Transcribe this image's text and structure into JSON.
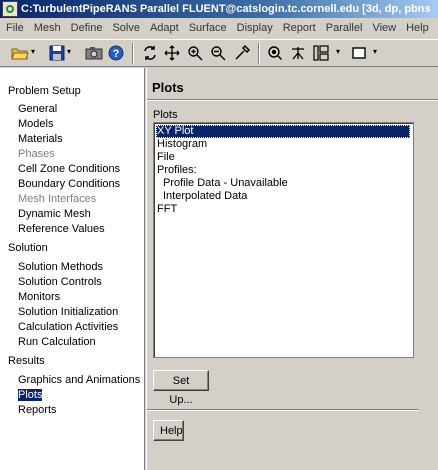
{
  "window": {
    "title": "C:TurbulentPipeRANS Parallel FLUENT@catslogin.tc.cornell.edu  [3d, dp, pbns"
  },
  "menubar": [
    "File",
    "Mesh",
    "Define",
    "Solve",
    "Adapt",
    "Surface",
    "Display",
    "Report",
    "Parallel",
    "View",
    "Help"
  ],
  "toolbar": {
    "icons": [
      "open-folder-icon",
      "save-icon",
      "screenshot-icon",
      "help-icon",
      "rotate-icon",
      "pan-icon",
      "zoom-in-out-icon",
      "zoom-to-area-icon",
      "probe-icon",
      "fit-to-window-icon",
      "mouse-probe-icon",
      "view-layout-icon",
      "display-box-icon"
    ]
  },
  "tree": {
    "sections": [
      {
        "header": "Problem Setup",
        "items": [
          {
            "label": "General",
            "disabled": false
          },
          {
            "label": "Models",
            "disabled": false
          },
          {
            "label": "Materials",
            "disabled": false
          },
          {
            "label": "Phases",
            "disabled": true
          },
          {
            "label": "Cell Zone Conditions",
            "disabled": false
          },
          {
            "label": "Boundary Conditions",
            "disabled": false
          },
          {
            "label": "Mesh Interfaces",
            "disabled": true
          },
          {
            "label": "Dynamic Mesh",
            "disabled": false
          },
          {
            "label": "Reference Values",
            "disabled": false
          }
        ]
      },
      {
        "header": "Solution",
        "items": [
          {
            "label": "Solution Methods",
            "disabled": false
          },
          {
            "label": "Solution Controls",
            "disabled": false
          },
          {
            "label": "Monitors",
            "disabled": false
          },
          {
            "label": "Solution Initialization",
            "disabled": false
          },
          {
            "label": "Calculation Activities",
            "disabled": false
          },
          {
            "label": "Run Calculation",
            "disabled": false
          }
        ]
      },
      {
        "header": "Results",
        "items": [
          {
            "label": "Graphics and Animations",
            "disabled": false
          },
          {
            "label": "Plots",
            "disabled": false,
            "selected": true
          },
          {
            "label": "Reports",
            "disabled": false
          }
        ]
      }
    ]
  },
  "panel": {
    "title": "Plots",
    "list_label": "Plots",
    "list_items": [
      {
        "label": "XY Plot",
        "indent": 0,
        "selected": true
      },
      {
        "label": "Histogram",
        "indent": 0
      },
      {
        "label": "File",
        "indent": 0
      },
      {
        "label": "Profiles:",
        "indent": 0
      },
      {
        "label": "Profile Data - Unavailable",
        "indent": 1
      },
      {
        "label": "Interpolated Data",
        "indent": 1
      },
      {
        "label": "FFT",
        "indent": 0
      }
    ],
    "setup_button": "Set Up...",
    "help_button": "Help"
  },
  "colors": {
    "selection": "#0a246a",
    "window_bg": "#d4d0c8",
    "disabled_text": "#808080"
  }
}
